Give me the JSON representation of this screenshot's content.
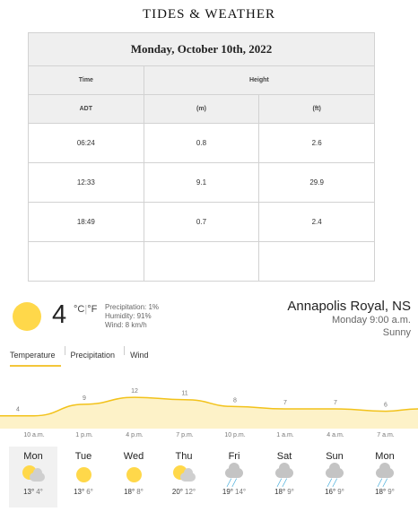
{
  "title": "TIDES & WEATHER",
  "tides": {
    "date": "Monday, October 10th, 2022",
    "headers": {
      "time": "Time",
      "height": "Height",
      "adt": "ADT",
      "m": "(m)",
      "ft": "(ft)"
    },
    "rows": [
      {
        "time": "06:24",
        "m": "0.8",
        "ft": "2.6"
      },
      {
        "time": "12:33",
        "m": "9.1",
        "ft": "29.9"
      },
      {
        "time": "18:49",
        "m": "0.7",
        "ft": "2.4"
      }
    ]
  },
  "current": {
    "temp": "4",
    "unit_c": "°C",
    "unit_sep": "|",
    "unit_f": "°F",
    "precipitation": "Precipitation: 1%",
    "humidity": "Humidity: 91%",
    "wind": "Wind: 8 km/h",
    "location": "Annapolis Royal, NS",
    "time": "Monday 9:00 a.m.",
    "condition": "Sunny",
    "icon": "sun-icon"
  },
  "tabs": [
    {
      "label": "Temperature",
      "active": true
    },
    {
      "label": "Precipitation",
      "active": false
    },
    {
      "label": "Wind",
      "active": false
    }
  ],
  "chart_data": {
    "type": "area",
    "x": [
      "10 a.m.",
      "1 p.m.",
      "4 p.m.",
      "7 p.m.",
      "10 p.m.",
      "1 a.m.",
      "4 a.m.",
      "7 a.m."
    ],
    "series": [
      {
        "values": [
          4,
          9,
          12,
          11,
          8,
          7,
          7,
          6
        ]
      }
    ],
    "ylim": [
      0,
      14
    ],
    "colors": {
      "line": "#f2c21a",
      "fill": "#fdf2c8"
    }
  },
  "days": [
    {
      "name": "Mon",
      "hi": "13°",
      "lo": "4°",
      "icon": "partly-cloudy-icon",
      "selected": true
    },
    {
      "name": "Tue",
      "hi": "13°",
      "lo": "6°",
      "icon": "sun-icon",
      "selected": false
    },
    {
      "name": "Wed",
      "hi": "18°",
      "lo": "8°",
      "icon": "sun-icon",
      "selected": false
    },
    {
      "name": "Thu",
      "hi": "20°",
      "lo": "12°",
      "icon": "partly-cloudy-icon",
      "selected": false
    },
    {
      "name": "Fri",
      "hi": "19°",
      "lo": "14°",
      "icon": "rain-icon",
      "selected": false
    },
    {
      "name": "Sat",
      "hi": "18°",
      "lo": "9°",
      "icon": "rain-icon",
      "selected": false
    },
    {
      "name": "Sun",
      "hi": "16°",
      "lo": "9°",
      "icon": "rain-icon",
      "selected": false
    },
    {
      "name": "Mon",
      "hi": "18°",
      "lo": "9°",
      "icon": "rain-partly-cloudy-icon",
      "selected": false
    }
  ]
}
